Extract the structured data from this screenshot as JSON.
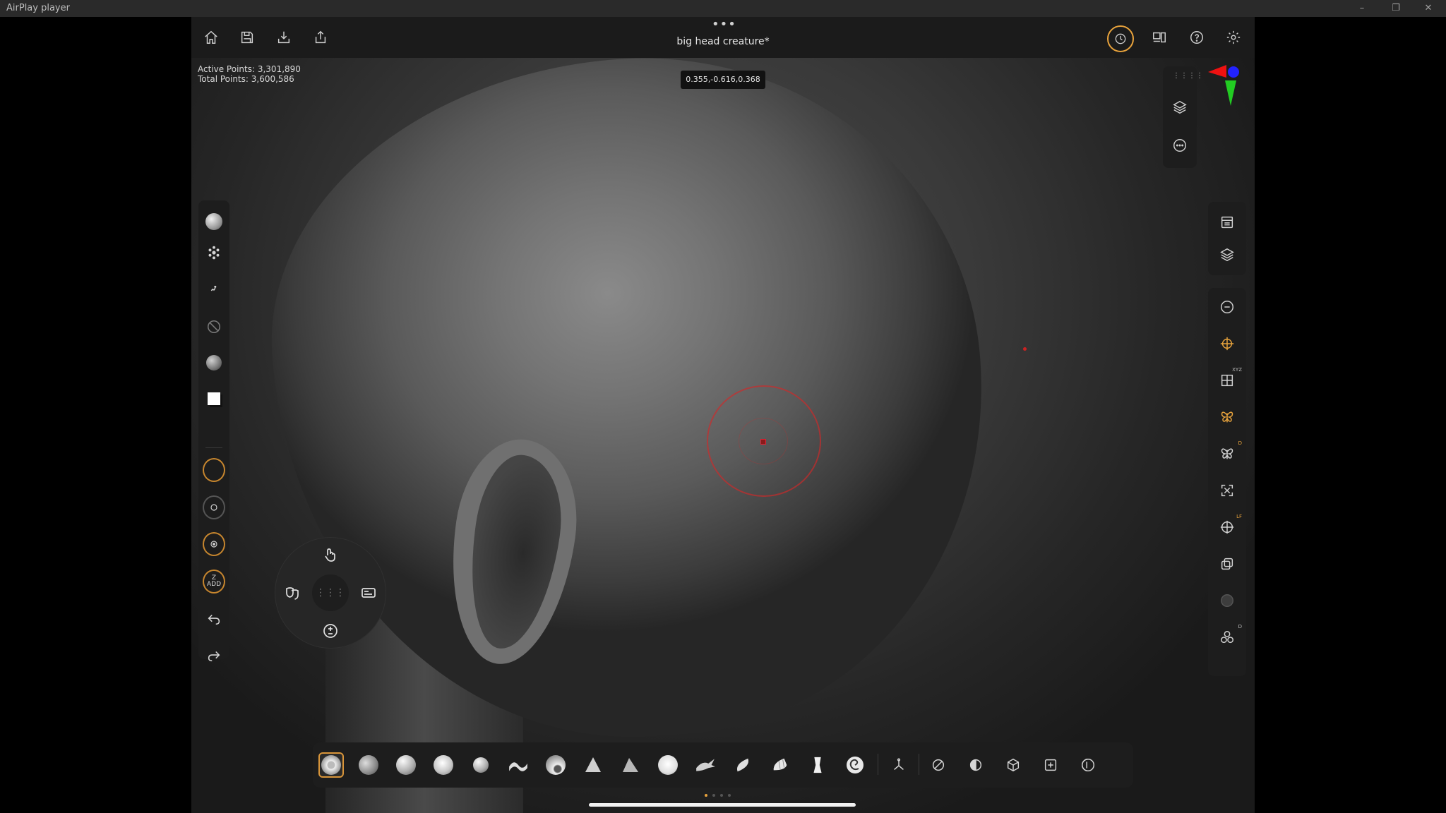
{
  "window": {
    "title": "AirPlay player",
    "controls": [
      "–",
      "❐",
      "✕"
    ]
  },
  "topbar": {
    "document_title": "big head creature*",
    "more_menu": "•••",
    "icons": [
      "home-icon",
      "save-icon",
      "import-icon",
      "export-icon",
      "history-icon",
      "layout-icon",
      "help-icon",
      "settings-icon"
    ]
  },
  "stats": {
    "active_points": "Active Points: 3,301,890",
    "total_points": "Total Points: 3,600,586"
  },
  "cursor": {
    "coordinates": "0.355,-0.616,0.368"
  },
  "left_toolbar": {
    "z_add": "Z\nADD",
    "items": [
      "brush-sphere",
      "spray-stroke",
      "dots-stroke",
      "alpha-off",
      "material-sphere",
      "color-swatch",
      "draw-size",
      "focal-shift",
      "intensity",
      "z-add",
      "undo",
      "redo"
    ]
  },
  "radial_menu": {
    "center": "⋮⋮⋮",
    "items": [
      "gesture",
      "masks",
      "panels",
      "subdivide"
    ]
  },
  "brush_bar": {
    "active_index": 0,
    "brushes": [
      "clay-buildup",
      "standard",
      "clay",
      "inflate",
      "dam-standard",
      "move",
      "smooth",
      "pinch",
      "trim",
      "flatten",
      "snake-hook",
      "polish",
      "h-polish",
      "curve",
      "spiral"
    ],
    "tools": [
      "transpose",
      "mask",
      "symmetry-half",
      "cube",
      "add-panel",
      "dynamic"
    ]
  },
  "colors": {
    "accent": "#e8a33c",
    "cursor_ring": "#d22828",
    "panel": "#1d1d1d"
  },
  "page_dots": {
    "count": 4,
    "active": 0
  }
}
